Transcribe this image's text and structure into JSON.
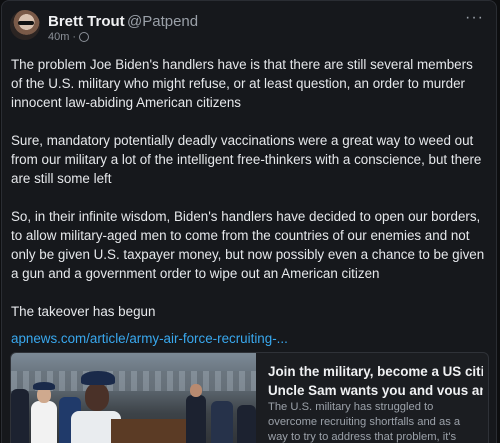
{
  "author": {
    "name": "Brett Trout",
    "handle": "@Patpend",
    "time": "40m",
    "separator": "·"
  },
  "icons": {
    "more": "more-options-icon",
    "visibility": "globe-icon"
  },
  "post": {
    "paragraphs": [
      "The problem Joe Biden's handlers have is that there are still several members of the U.S. military who might refuse, or at least question, an order to murder innocent law-abiding American citizens",
      "Sure, mandatory potentially deadly vaccinations were a great way to weed out from our military a lot of the intelligent free-thinkers with a conscience, but there are still some left",
      "So, in their infinite wisdom, Biden's handlers have decided to open our borders, to allow military-aged men to come from the countries of our enemies and not only be given U.S. taxpayer money, but now possibly even a chance to be given a gun and a government order to wipe out an American citizen",
      "The takeover has begun"
    ],
    "link": "apnews.com/article/army-air-force-recruiting-..."
  },
  "card": {
    "title_line1": "Join the military, become a US citizen:",
    "title_line2": "Uncle Sam wants you and vous and tu",
    "description": "The U.S. military has struggled to overcome recruiting shortfalls and as a way to try to address that problem, it's stepping up efforts"
  },
  "colors": {
    "background": "#16181c",
    "text": "#e6e8eb",
    "link": "#39a8ee",
    "muted": "#9aa0a8"
  }
}
